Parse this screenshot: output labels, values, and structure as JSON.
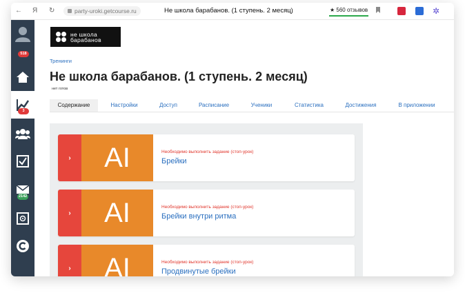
{
  "browser": {
    "url": "party-urokі.getcourse.ru",
    "tab_title": "Не школа барабанов. (1 ступень. 2 месяц)",
    "reviews": "★ 560 отзывов",
    "yandex": "Я"
  },
  "sidebar": {
    "badges": {
      "training": "3",
      "messages": "2142",
      "profile": "518"
    }
  },
  "logo": {
    "line1": "не школа",
    "line2": "барабанов"
  },
  "breadcrumb": "Тренинги",
  "page": {
    "title": "Не школа барабанов. (1 ступень. 2 месяц)",
    "subtitle": "нет готов"
  },
  "tabs": [
    {
      "label": "Содержание"
    },
    {
      "label": "Настройки"
    },
    {
      "label": "Доступ"
    },
    {
      "label": "Расписание"
    },
    {
      "label": "Ученики"
    },
    {
      "label": "Статистика"
    },
    {
      "label": "Достижения"
    },
    {
      "label": "В приложении"
    }
  ],
  "lessons": [
    {
      "thumb": "AI",
      "warning": "Необходимо выполнить задание (стоп-урок)",
      "name": "Брейки"
    },
    {
      "thumb": "AI",
      "warning": "Необходимо выполнить задание (стоп-урок)",
      "name": "Брейки внутри ритма"
    },
    {
      "thumb": "AI",
      "warning": "Необходимо выполнить задание (стоп-урок)",
      "name": "Продвинутые брейки"
    }
  ],
  "colors": {
    "sidebar": "#2f3e4f",
    "accent_link": "#2a6fbf",
    "lesson_arrow": "#e6463c",
    "lesson_thumb": "#e8892a",
    "warning": "#e0352b"
  }
}
